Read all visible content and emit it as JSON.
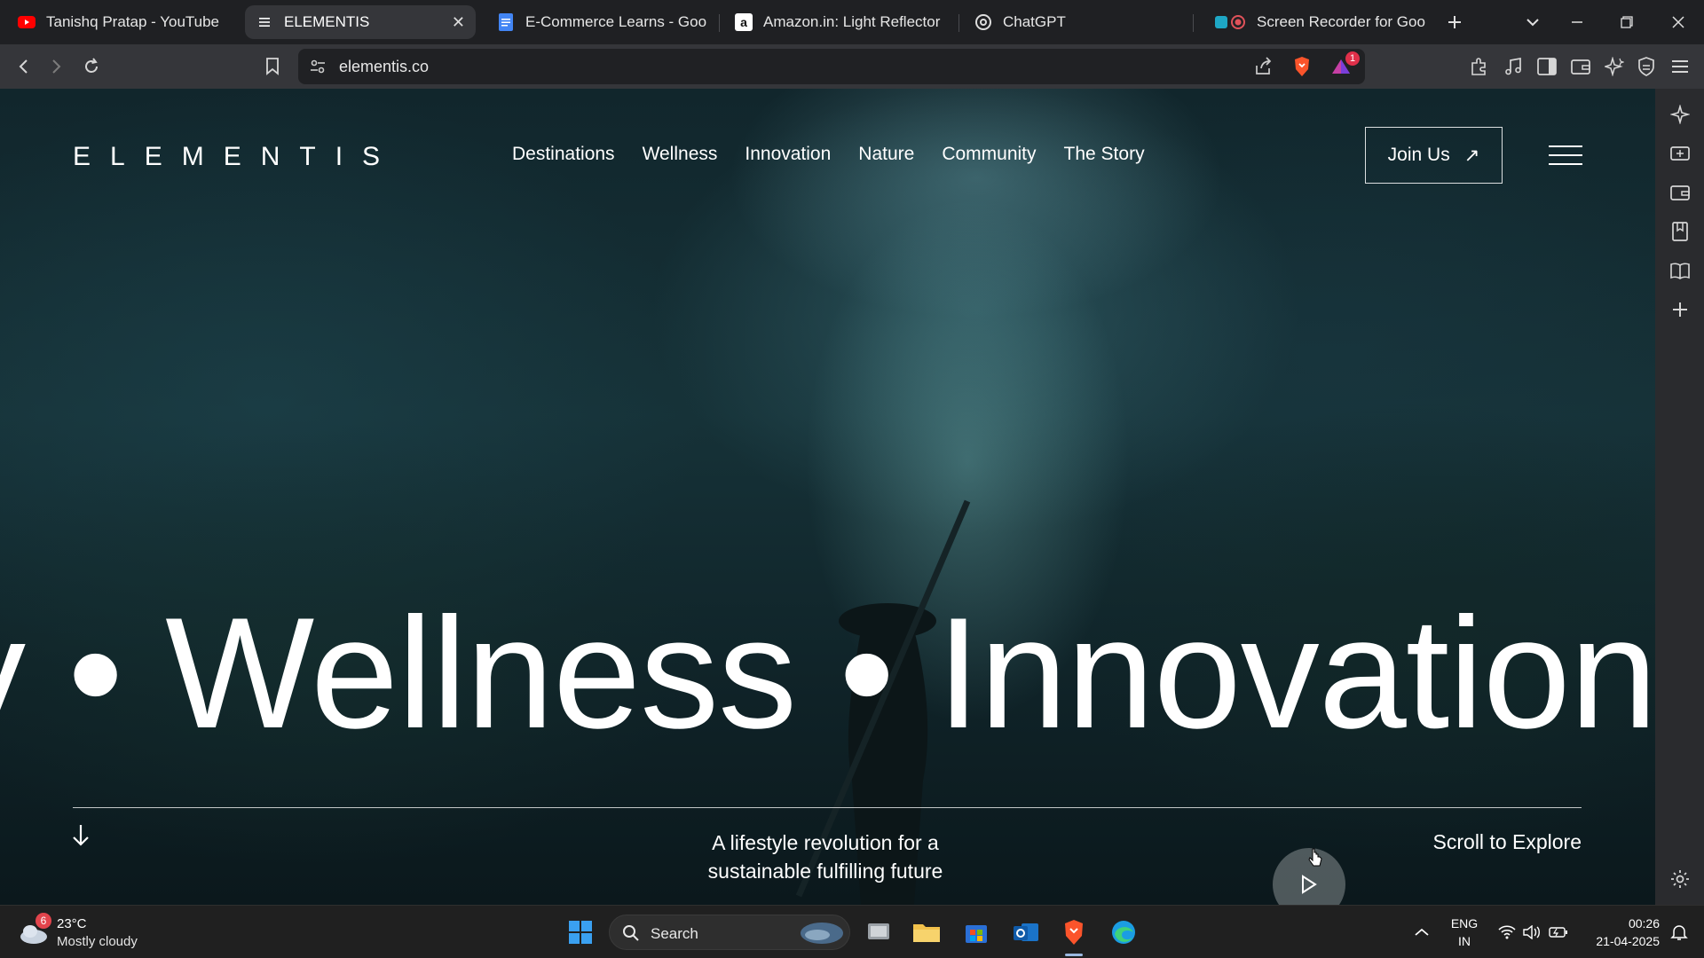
{
  "browser": {
    "tabs": [
      {
        "title": "Tanishq Pratap - YouTube",
        "icon": "youtube-icon",
        "active": false
      },
      {
        "title": "ELEMENTIS",
        "icon": "elementis-favicon",
        "active": true
      },
      {
        "title": "E-Commerce Learns - Google D",
        "icon": "google-docs-icon",
        "active": false
      },
      {
        "title": "Amazon.in: Light Reflector",
        "icon": "amazon-icon",
        "active": false
      },
      {
        "title": "ChatGPT",
        "icon": "chatgpt-icon",
        "active": false
      },
      {
        "title": "Screen Recorder for Google",
        "icon": "screen-recorder-icon",
        "active": false
      }
    ],
    "url": "elementis.co",
    "notification_count": "1"
  },
  "site": {
    "logo": "ELEMENTIS",
    "nav": [
      "Destinations",
      "Wellness",
      "Innovation",
      "Nature",
      "Community",
      "The Story"
    ],
    "join_label": "Join Us",
    "join_arrow": "↗",
    "marquee": "y • Wellness • Innovation",
    "tagline": "A lifestyle revolution for a sustainable fulfilling future",
    "scroll_label": "Scroll to Explore"
  },
  "taskbar": {
    "weather_badge": "6",
    "temperature": "23°C",
    "weather": "Mostly cloudy",
    "search_label": "Search",
    "lang_top": "ENG",
    "lang_bottom": "IN",
    "time": "00:26",
    "date": "21-04-2025"
  },
  "colors": {
    "brand_red": "#fb542b",
    "youtube_red": "#ff0000",
    "docs_blue": "#4285f4",
    "hero_teal": "#163238"
  }
}
